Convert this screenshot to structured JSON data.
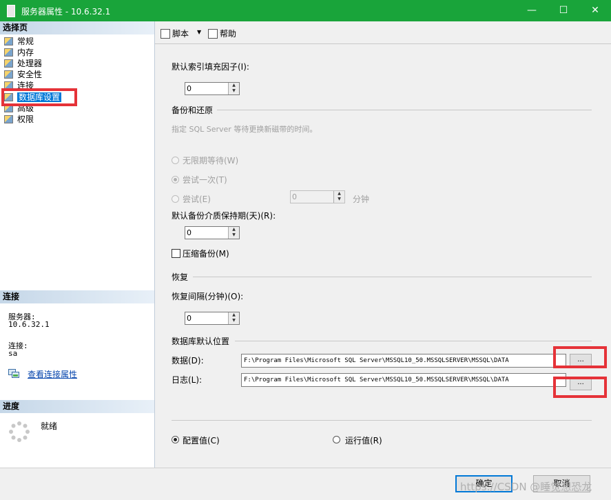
{
  "window": {
    "title": "服务器属性 - 10.6.32.1",
    "minimize": "—",
    "maximize": "☐",
    "close": "✕"
  },
  "left_pane": {
    "select_page_header": "选择页",
    "nav_items": [
      {
        "label": "常规",
        "icon": "page-icon"
      },
      {
        "label": "内存",
        "icon": "page-icon"
      },
      {
        "label": "处理器",
        "icon": "page-icon"
      },
      {
        "label": "安全性",
        "icon": "page-icon"
      },
      {
        "label": "连接",
        "icon": "page-icon"
      },
      {
        "label": "数据库设置",
        "icon": "page-icon",
        "selected": true
      },
      {
        "label": "高级",
        "icon": "page-icon"
      },
      {
        "label": "权限",
        "icon": "page-icon"
      }
    ],
    "connection_header": "连接",
    "server_label": "服务器:",
    "server_value": "10.6.32.1",
    "connection_label": "连接:",
    "connection_value": "sa",
    "view_connection_link": "查看连接属性",
    "progress_header": "进度",
    "progress_status": "就绪"
  },
  "toolbar": {
    "script_label": "脚本",
    "script_dropdown": "▼",
    "help_label": "帮助"
  },
  "main": {
    "fill_factor_label": "默认索引填充因子(I):",
    "fill_factor_value": "0",
    "backup_restore_group": "备份和还原",
    "backup_hint": "指定 SQL Server 等待更换新磁带的时间。",
    "wait_indefinitely": "无限期等待(W)",
    "try_once": "尝试一次(T)",
    "try_label": "尝试(E)",
    "try_minutes_value": "0",
    "minutes_label": "分钟",
    "retention_label": "默认备份介质保持期(天)(R):",
    "retention_value": "0",
    "compress_backup": "压缩备份(M)",
    "recovery_group": "恢复",
    "recovery_interval_label": "恢复间隔(分钟)(O):",
    "recovery_interval_value": "0",
    "db_default_location_group": "数据库默认位置",
    "data_label": "数据(D):",
    "data_path": "F:\\Program Files\\Microsoft SQL Server\\MSSQL10_50.MSSQLSERVER\\MSSQL\\DATA",
    "log_label": "日志(L):",
    "log_path": "F:\\Program Files\\Microsoft SQL Server\\MSSQL10_50.MSSQLSERVER\\MSSQL\\DATA",
    "browse_label": "...",
    "configured_values": "配置值(C)",
    "running_values": "运行值(R)"
  },
  "footer": {
    "ok_label": "确定",
    "cancel_label": "取消",
    "watermark": "https://CSDN @睡觉想恐龙"
  },
  "colors": {
    "title_bar": "#19a43a",
    "selection": "#0078d7",
    "annotation_red": "#e53238"
  }
}
